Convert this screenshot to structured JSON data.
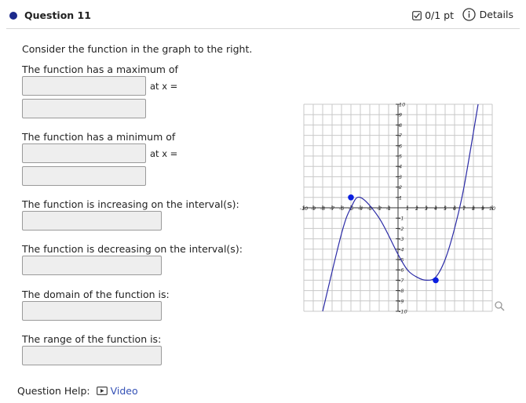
{
  "header": {
    "question_title": "Question 11",
    "score": "0/1 pt",
    "details_label": "Details"
  },
  "body": {
    "intro": "Consider the function in the graph to the right.",
    "max_label": "The function has a maximum of",
    "max_at_label": "at x =",
    "min_label": "The function has a minimum of",
    "min_at_label": "at x =",
    "increasing_label": "The function is increasing on the interval(s):",
    "decreasing_label": "The function is decreasing on the interval(s):",
    "domain_label": "The domain of the function is:",
    "range_label": "The range of the function is:"
  },
  "help": {
    "label": "Question Help:",
    "video_label": "Video"
  },
  "chart_data": {
    "type": "line",
    "title": "",
    "xlabel": "",
    "ylabel": "",
    "xlim": [
      -10,
      10
    ],
    "ylim": [
      -10,
      10
    ],
    "grid": true,
    "x_ticks": [
      "-10",
      "-9",
      "-8",
      "-7",
      "-6",
      "-5",
      "-4",
      "-3",
      "-2",
      "-1",
      "1",
      "2",
      "3",
      "4",
      "5",
      "6",
      "7",
      "8",
      "9",
      "10"
    ],
    "y_ticks": [
      "10",
      "9",
      "8",
      "7",
      "6",
      "5",
      "4",
      "3",
      "2",
      "1",
      "-1",
      "-2",
      "-3",
      "-4",
      "-5",
      "-6",
      "-7",
      "-8",
      "-9",
      "-10"
    ],
    "curve": {
      "x": [
        -8,
        -6,
        -5,
        -4,
        -2,
        0,
        1,
        2,
        3,
        4,
        5,
        6,
        7,
        8.5
      ],
      "y": [
        -10,
        -2.5,
        0,
        1,
        -1,
        -4.5,
        -6,
        -6.7,
        -7,
        -6.7,
        -5,
        -2,
        2,
        10
      ]
    },
    "points": [
      {
        "x": -5,
        "y": 1
      },
      {
        "x": 4,
        "y": -7
      }
    ],
    "colors": {
      "curve": "#2a2aa6",
      "point": "#0a1ee0",
      "grid": "#c8c8c8",
      "axis": "#333333"
    }
  }
}
